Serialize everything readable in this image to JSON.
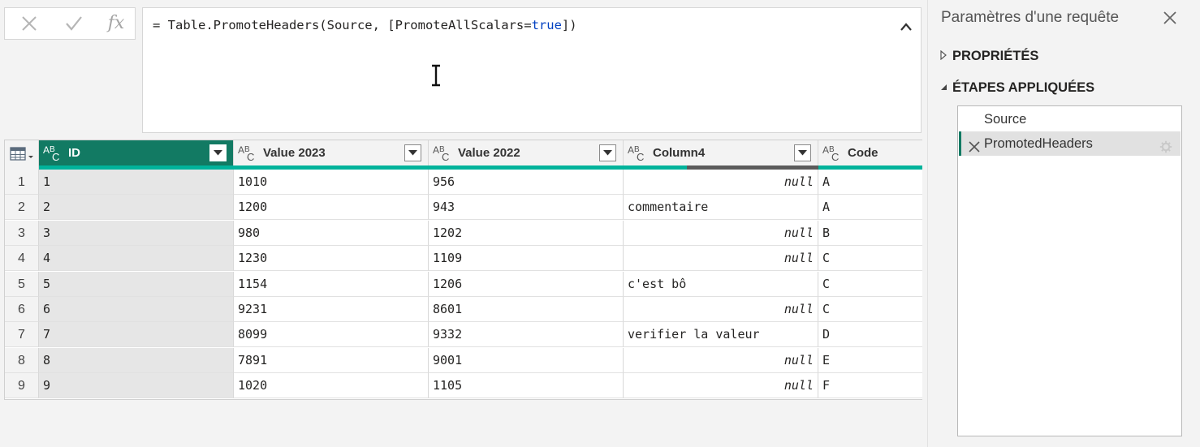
{
  "formula_bar": {
    "fx_label": "fx",
    "formula_prefix": "= Table.PromoteHeaders(Source, [PromoteAllScalars=",
    "formula_keyword": "true",
    "formula_suffix": "])"
  },
  "grid": {
    "columns": [
      {
        "name": "ID",
        "type": "ABC",
        "active": true
      },
      {
        "name": "Value 2023",
        "type": "ABC"
      },
      {
        "name": "Value 2022",
        "type": "ABC"
      },
      {
        "name": "Column4",
        "type": "ABC"
      },
      {
        "name": "Code",
        "type": "ABC"
      }
    ],
    "rows": [
      {
        "n": "1",
        "cells": [
          "1",
          "1010",
          "956",
          "null",
          "A"
        ]
      },
      {
        "n": "2",
        "cells": [
          "2",
          "1200",
          "943",
          "commentaire",
          "A"
        ]
      },
      {
        "n": "3",
        "cells": [
          "3",
          "980",
          "1202",
          "null",
          "B"
        ]
      },
      {
        "n": "4",
        "cells": [
          "4",
          "1230",
          "1109",
          "null",
          "C"
        ]
      },
      {
        "n": "5",
        "cells": [
          "5",
          "1154",
          "1206",
          "c'est bô",
          "C"
        ]
      },
      {
        "n": "6",
        "cells": [
          "6",
          "9231",
          "8601",
          "null",
          "C"
        ]
      },
      {
        "n": "7",
        "cells": [
          "7",
          "8099",
          "9332",
          "verifier la valeur",
          "D"
        ]
      },
      {
        "n": "8",
        "cells": [
          "8",
          "7891",
          "9001",
          "null",
          "E"
        ]
      },
      {
        "n": "9",
        "cells": [
          "9",
          "1020",
          "1105",
          "null",
          "F"
        ]
      }
    ]
  },
  "query_settings": {
    "title": "Paramètres d'une requête",
    "properties_label": "PROPRIÉTÉS",
    "applied_steps_label": "ÉTAPES APPLIQUÉES",
    "steps": [
      {
        "label": "Source"
      },
      {
        "label": "PromotedHeaders",
        "active": true
      }
    ]
  },
  "colors": {
    "accent": "#127a63",
    "quality_valid": "#00b39b",
    "quality_empty": "#5b5b5b",
    "keyword": "#0040c1"
  }
}
